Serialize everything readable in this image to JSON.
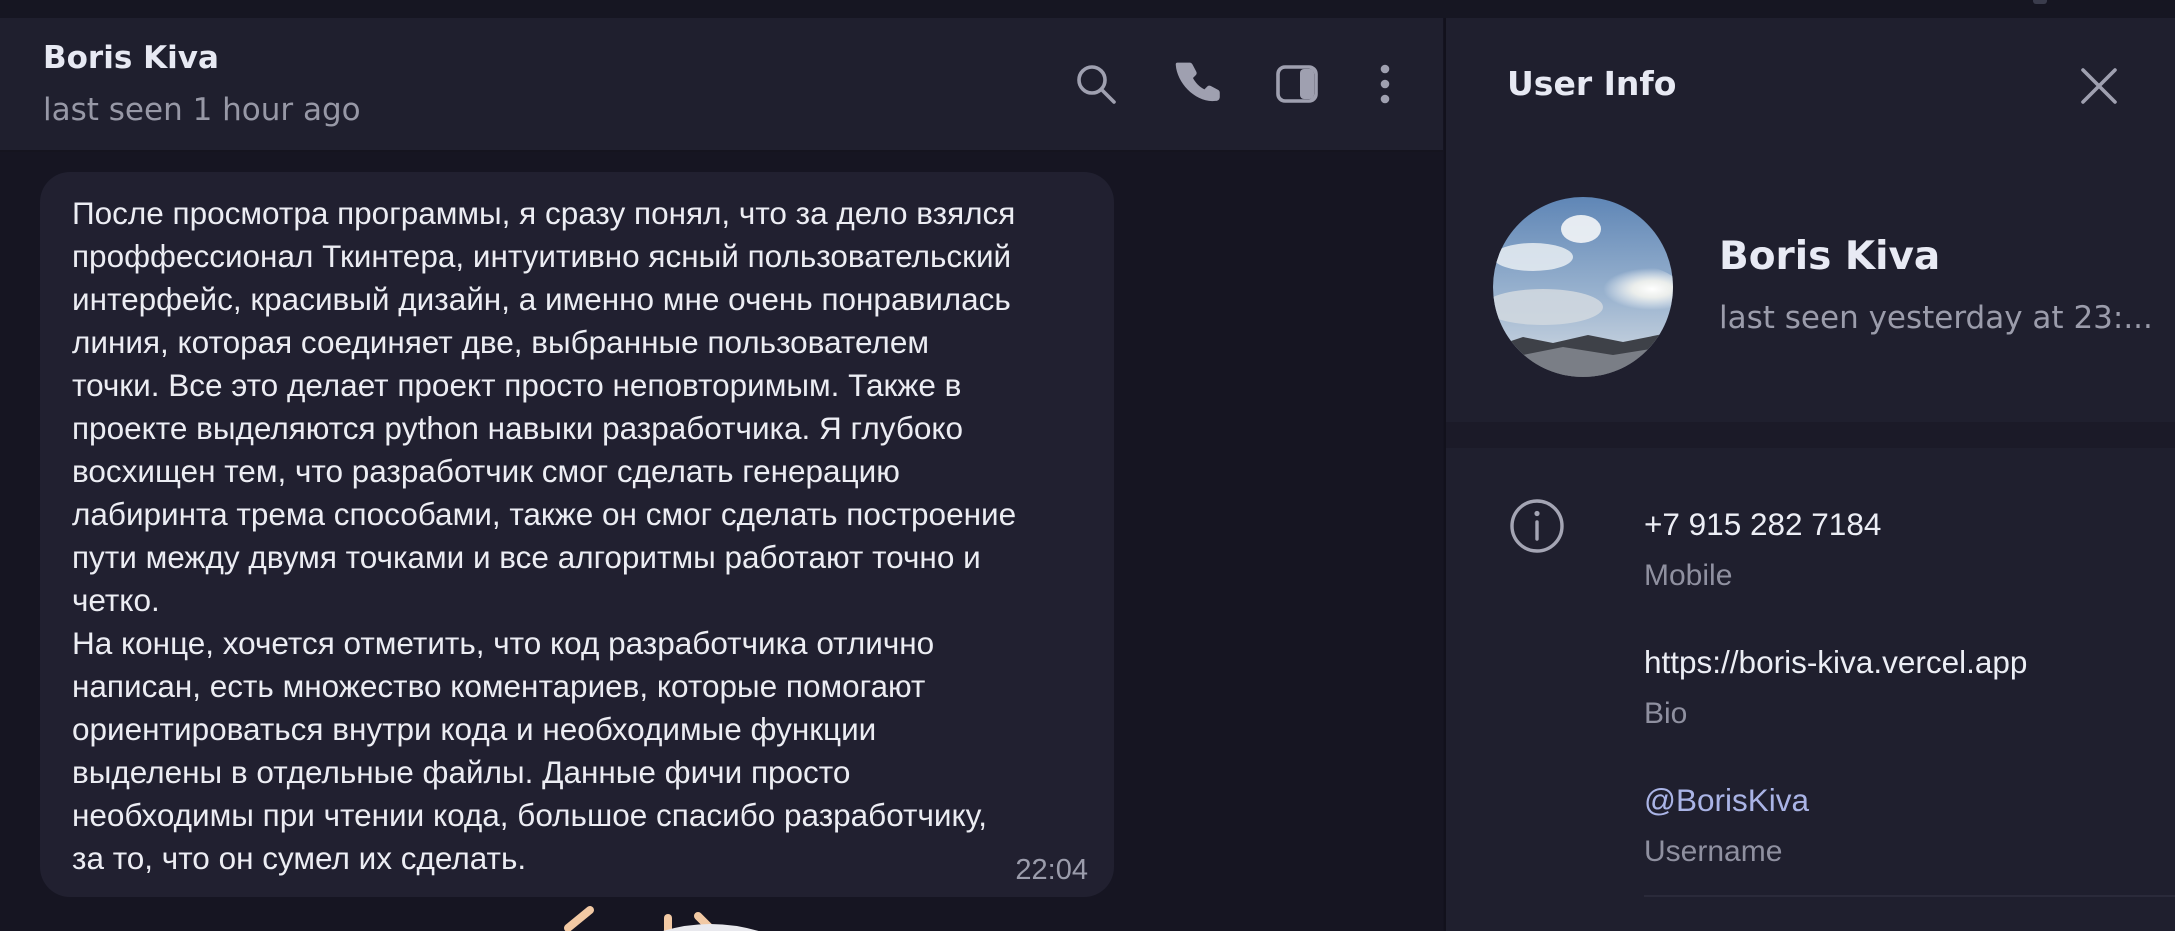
{
  "chat": {
    "contact_name": "Boris Kiva",
    "contact_status": "last seen 1 hour ago",
    "header_icons": [
      "search-icon",
      "phone-icon",
      "sidebar-toggle-icon",
      "more-vertical-icon"
    ]
  },
  "message": {
    "text": "После просмотра программы, я сразу понял, что за дело взялся\nпроффессионал Ткинтера, интуитивно ясный пользовательский\nинтерфейс, красивый дизайн, а именно мне очень понравилась\nлиния, которая соединяет две, выбранные пользователем\nточки. Все это делает проект просто неповторимым. Также в\nпроекте выделяются python навыки разработчика. Я глубоко\nвосхищен тем, что разработчик смог сделать генерацию\nлабиринта трема способами, также он смог сделать построение\nпути между двумя точками и все алгоритмы работают точно и\nчетко.\nНа конце, хочется отметить, что код разработчика отлично\nнаписан, есть множество коментариев, которые помогают\nориентироваться внутри кода и необходимые функции\nвыделены в отдельные файлы. Данные фичи просто\nнеобходимы при чтении кода, большое спасибо разработчику,\nза то, что он сумел их сделать.",
    "time": "22:04"
  },
  "user_info": {
    "title": "User Info",
    "name": "Boris Kiva",
    "status": "last seen yesterday at 23:...",
    "phone": "+7 915 282 7184",
    "phone_label": "Mobile",
    "bio": "https://boris-kiva.vercel.app",
    "bio_label": "Bio",
    "username": "@BorisKiva",
    "username_label": "Username"
  },
  "colors": {
    "background": "#161522",
    "header": "#1f1f2e",
    "bubble": "#212030",
    "link": "#aab4e6"
  }
}
